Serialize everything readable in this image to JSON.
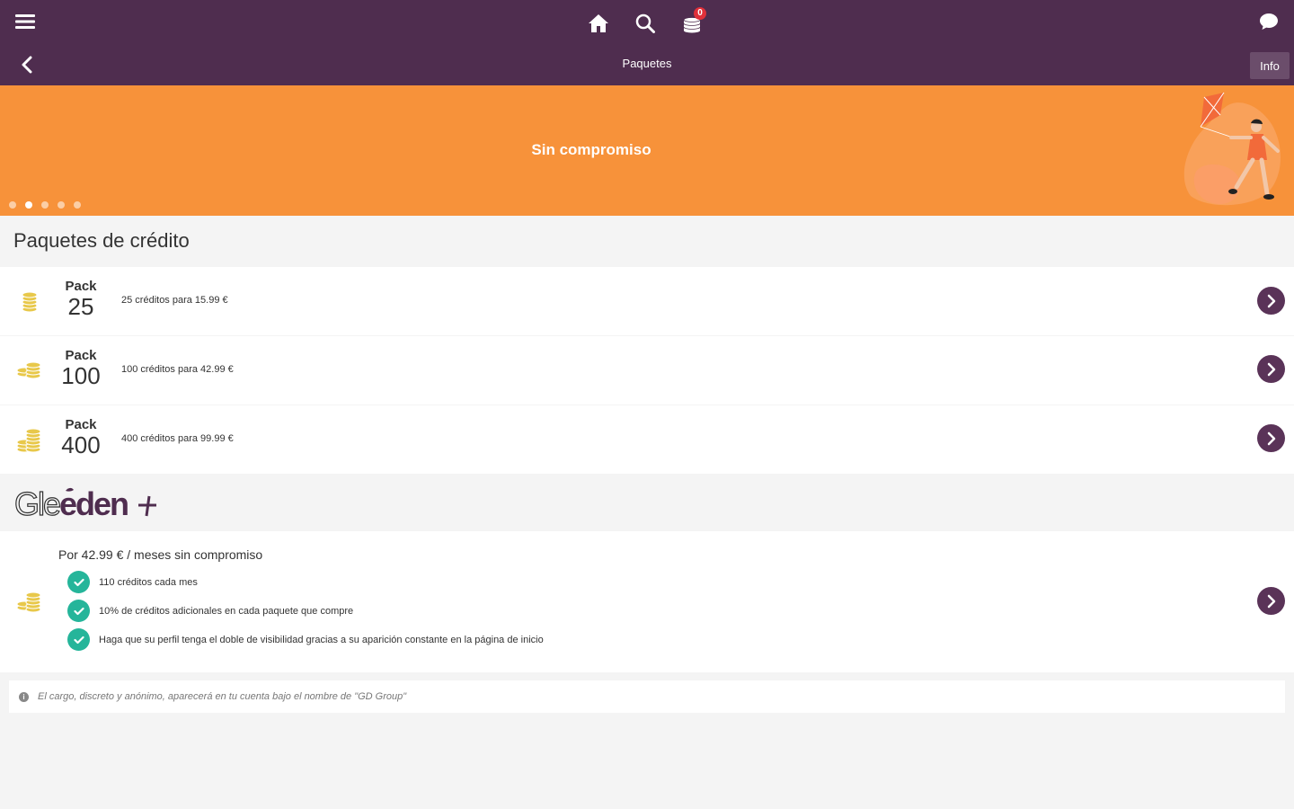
{
  "header": {
    "title": "Paquetes",
    "info_label": "Info",
    "credits_badge": "0"
  },
  "banner": {
    "text": "Sin compromiso",
    "dots_total": 5,
    "active_dot": 2,
    "color": "#f7923a"
  },
  "section_title": "Paquetes de crédito",
  "packs": [
    {
      "label": "Pack",
      "number": "25",
      "description": "25 créditos para 15.99 €"
    },
    {
      "label": "Pack",
      "number": "100",
      "description": "100 créditos para 42.99 €"
    },
    {
      "label": "Pack",
      "number": "400",
      "description": "400 créditos para 99.99 €"
    }
  ],
  "subscription": {
    "brand": "Gleeden +",
    "price_text": "Por 42.99 € / meses sin compromiso",
    "features": [
      "110 créditos cada mes",
      "10% de créditos adicionales en cada paquete que compre",
      "Haga que su perfil tenga el doble de visibilidad gracias a su aparición constante en la página de inicio"
    ]
  },
  "note": {
    "text": "El cargo, discreto y anónimo, aparecerá en tu cuenta bajo el nombre de \"GD Group\""
  },
  "colors": {
    "header_bg": "#4f2d4f",
    "accent": "#5a3358",
    "check": "#25b59a",
    "badge": "#e0303a",
    "coin": "#e8c84a"
  }
}
